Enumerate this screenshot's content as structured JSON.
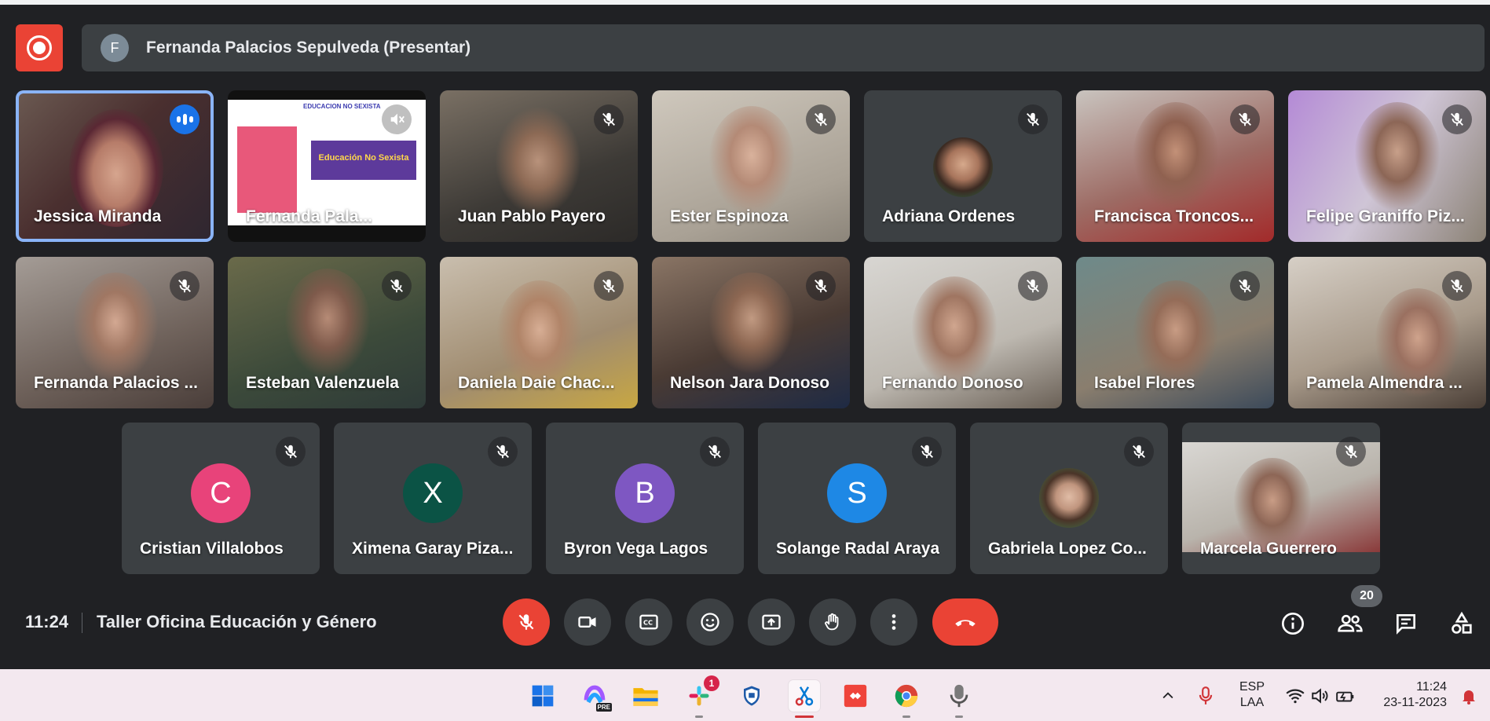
{
  "presenter_bar": {
    "avatar_letter": "F",
    "text": "Fernanda Palacios Sepulveda (Presentar)"
  },
  "participants": [
    {
      "name": "Jessica Miranda",
      "status": "speaking"
    },
    {
      "name": "Fernanda Pala...",
      "status": "presenting-muted"
    },
    {
      "name": "Juan Pablo Payero",
      "status": "muted"
    },
    {
      "name": "Ester Espinoza",
      "status": "muted"
    },
    {
      "name": "Adriana Ordenes",
      "status": "muted"
    },
    {
      "name": "Francisca Troncos...",
      "status": "muted"
    },
    {
      "name": "Felipe Graniffo Piz...",
      "status": "muted"
    },
    {
      "name": "Fernanda Palacios ...",
      "status": "muted"
    },
    {
      "name": "Esteban Valenzuela",
      "status": "muted"
    },
    {
      "name": "Daniela Daie Chac...",
      "status": "muted"
    },
    {
      "name": "Nelson Jara Donoso",
      "status": "muted"
    },
    {
      "name": "Fernando Donoso",
      "status": "muted"
    },
    {
      "name": "Isabel Flores",
      "status": "muted"
    },
    {
      "name": "Pamela Almendra ...",
      "status": "muted"
    },
    {
      "name": "Cristian Villalobos",
      "status": "muted",
      "avatar_letter": "C",
      "avatar_color": "#e8437a"
    },
    {
      "name": "Ximena Garay Piza...",
      "status": "muted",
      "avatar_letter": "X",
      "avatar_color": "#0b5345"
    },
    {
      "name": "Byron Vega Lagos",
      "status": "muted",
      "avatar_letter": "B",
      "avatar_color": "#7e57c2"
    },
    {
      "name": "Solange Radal Araya",
      "status": "muted",
      "avatar_letter": "S",
      "avatar_color": "#1e88e5"
    },
    {
      "name": "Gabriela Lopez Co...",
      "status": "muted"
    },
    {
      "name": "Marcela Guerrero",
      "status": "muted"
    }
  ],
  "slide": {
    "header": "EDUCACION NO SEXISTA",
    "title": "Educación No Sexista"
  },
  "bottom_bar": {
    "time": "11:24",
    "meeting_title": "Taller Oficina Educación y Género",
    "people_count": "20"
  },
  "taskbar": {
    "slack_badge": "1",
    "copilot_badge": "PRE",
    "language": "ESP",
    "layout": "LAA",
    "time": "11:24",
    "date": "23-11-2023"
  },
  "colors": {
    "accent": "#8ab4f8",
    "red": "#ea4335",
    "tile": "#3c4043",
    "background": "#202124"
  }
}
